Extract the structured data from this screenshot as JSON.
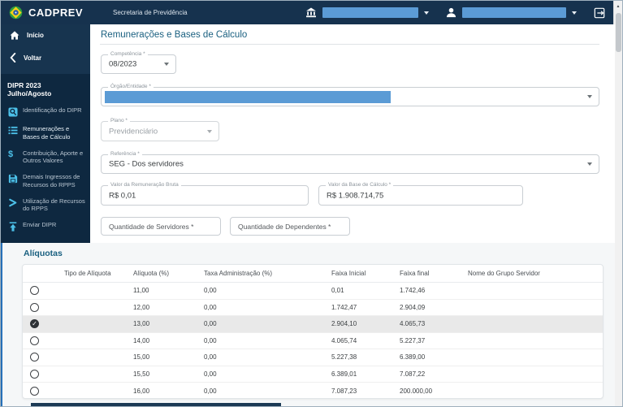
{
  "colors": {
    "header_bg": "#16324e",
    "sidebar_bg": "#17344f",
    "sidebar_section_bg": "#0e2840",
    "accent_cyan": "#4cc0e8",
    "redaction_blue": "#5b9bd5",
    "title_blue": "#1a6080",
    "selected_row_bg": "#e9e9e9",
    "section_bg": "#f5f7f8",
    "bottom_bar": "#1c3a55"
  },
  "header": {
    "brand": "CADPREV",
    "subtitle": "Secretaria de Previdência",
    "entity_select": {
      "icon": "bank-icon",
      "value": ""
    },
    "user_select": {
      "icon": "person-icon",
      "value": ""
    },
    "logout_icon": "logout-icon"
  },
  "sidebar": {
    "nav_top": [
      {
        "label": "Início",
        "icon": "home-icon"
      },
      {
        "label": "Voltar",
        "icon": "chevron-left-icon"
      }
    ],
    "section_title": "DIPR 2023 Julho/Agosto",
    "items": [
      {
        "label": "Identificação do DIPR",
        "icon": "document-id-icon",
        "active": false
      },
      {
        "label": "Remunerações e Bases de Cálculo",
        "icon": "list-icon",
        "active": true
      },
      {
        "label": "Contribuição, Aporte e Outros Valores",
        "icon": "dollar-icon",
        "active": false
      },
      {
        "label": "Demais Ingressos de Recursos do RPPS",
        "icon": "save-icon",
        "active": false
      },
      {
        "label": "Utilização de Recursos do RPPS",
        "icon": "arrow-right-icon",
        "active": false
      },
      {
        "label": "Enviar DIPR",
        "icon": "upload-icon",
        "active": false
      }
    ]
  },
  "form": {
    "title": "Remunerações e Bases de Cálculo",
    "competencia": {
      "label": "Competência *",
      "value": "08/2023"
    },
    "orgao_entidade": {
      "label": "Órgão/Entidade *",
      "value": ""
    },
    "plano": {
      "label": "Plano *",
      "value": "Previdenciário",
      "disabled": true
    },
    "referencia": {
      "label": "Referência *",
      "value": "SEG - Dos servidores"
    },
    "valor_remuneracao_bruta": {
      "label": "Valor da Remuneração Bruta",
      "value": "R$ 0,01"
    },
    "valor_base_calculo": {
      "label": "Valor da Base de Cálculo *",
      "value": "R$ 1.908.714,75"
    },
    "quantidade_servidores": {
      "label": "Quantidade de Servidores *",
      "value": ""
    },
    "quantidade_dependentes": {
      "label": "Quantidade de Dependentes *",
      "value": ""
    }
  },
  "aliquotas": {
    "title": "Alíquotas",
    "columns": [
      "Tipo de Alíquota",
      "Alíquota (%)",
      "Taxa Administração (%)",
      "Faixa Inicial",
      "Faixa final",
      "Nome do Grupo Servidor"
    ],
    "selected_row_index": 2,
    "rows": [
      {
        "aliquota": "11,00",
        "taxa_admin": "0,00",
        "faixa_inicial": "0,01",
        "faixa_final": "1.742,46",
        "grupo": ""
      },
      {
        "aliquota": "12,00",
        "taxa_admin": "0,00",
        "faixa_inicial": "1.742,47",
        "faixa_final": "2.904,09",
        "grupo": ""
      },
      {
        "aliquota": "13,00",
        "taxa_admin": "0,00",
        "faixa_inicial": "2.904,10",
        "faixa_final": "4.065,73",
        "grupo": ""
      },
      {
        "aliquota": "14,00",
        "taxa_admin": "0,00",
        "faixa_inicial": "4.065,74",
        "faixa_final": "5.227,37",
        "grupo": ""
      },
      {
        "aliquota": "15,00",
        "taxa_admin": "0,00",
        "faixa_inicial": "5.227,38",
        "faixa_final": "6.389,00",
        "grupo": ""
      },
      {
        "aliquota": "15,50",
        "taxa_admin": "0,00",
        "faixa_inicial": "6.389,01",
        "faixa_final": "7.087,22",
        "grupo": ""
      },
      {
        "aliquota": "16,00",
        "taxa_admin": "0,00",
        "faixa_inicial": "7.087,23",
        "faixa_final": "200.000,00",
        "grupo": ""
      }
    ]
  }
}
